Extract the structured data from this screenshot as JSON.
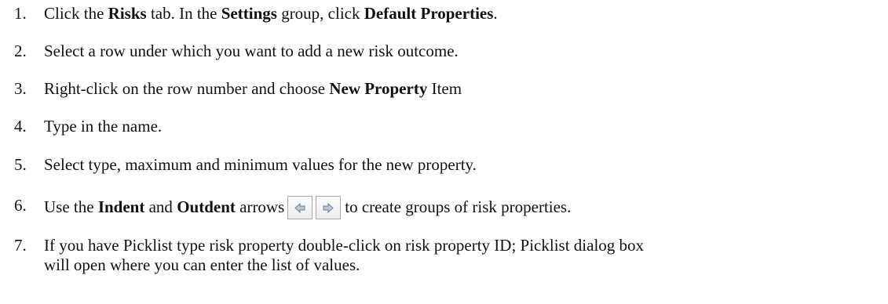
{
  "steps": [
    {
      "number": "1.",
      "parts": [
        "Click the ",
        "Risks",
        " tab. In the ",
        "Settings",
        " group, click ",
        "Default Properties",
        "."
      ]
    },
    {
      "number": "2.",
      "text": "Select a row under which you want to add a new risk outcome."
    },
    {
      "number": "3.",
      "parts": [
        "Right-click on the row number and choose ",
        "New Property",
        " Item"
      ]
    },
    {
      "number": "4.",
      "text": "Type in the name."
    },
    {
      "number": "5.",
      "text": "Select type, maximum and minimum values for the new property."
    },
    {
      "number": "6.",
      "parts": [
        "Use the ",
        "Indent",
        " and ",
        "Outdent",
        " arrows",
        "to create groups of risk properties."
      ],
      "icons": [
        "left-arrow-icon",
        "right-arrow-icon"
      ]
    },
    {
      "number": "7.",
      "line1": "If you have Picklist type risk property double-click on risk property ID; Picklist dialog box",
      "line2": "will open where you can enter the list of values."
    }
  ]
}
